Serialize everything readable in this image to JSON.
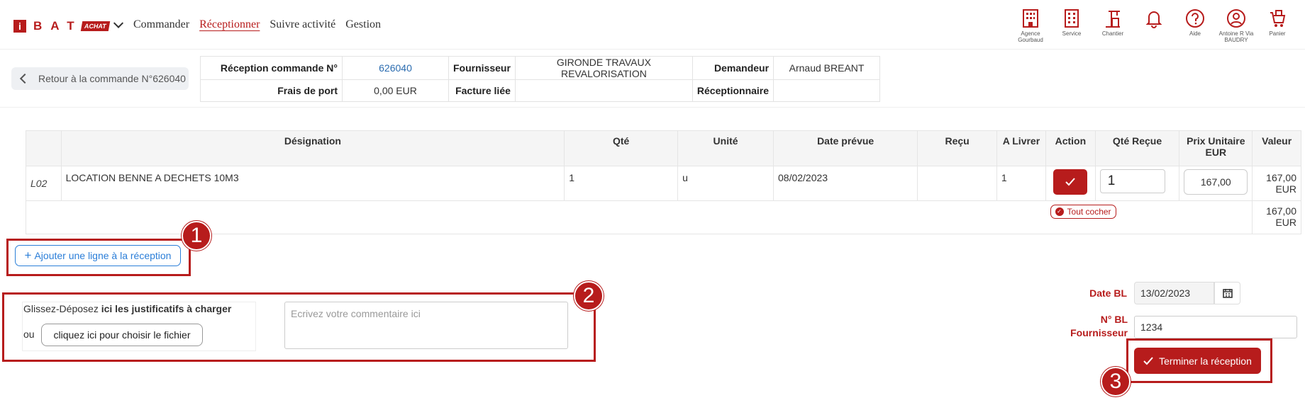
{
  "nav": {
    "logo_letters": "BAT",
    "logo_badge": "ACHAT",
    "menu": [
      "Commander",
      "Réceptionner",
      "Suivre activité",
      "Gestion"
    ],
    "icons": [
      {
        "label": "Agence Gourbaud"
      },
      {
        "label": "Service"
      },
      {
        "label": "Chantier"
      },
      {
        "label": ""
      },
      {
        "label": "Aide"
      },
      {
        "label": "Antoine R Via BAUDRY"
      },
      {
        "label": "Panier"
      }
    ]
  },
  "back_button": "Retour à la commande N°626040",
  "info": {
    "reception_label": "Réception commande N°",
    "reception_value": "626040",
    "fournisseur_label": "Fournisseur",
    "fournisseur_value": "GIRONDE TRAVAUX REVALORISATION",
    "demandeur_label": "Demandeur",
    "demandeur_value": "Arnaud BREANT",
    "frais_label": "Frais de port",
    "frais_value": "0,00 EUR",
    "facture_label": "Facture liée",
    "facture_value": "",
    "receptionnaire_label": "Réceptionnaire",
    "receptionnaire_value": ""
  },
  "table": {
    "headers": [
      "",
      "Désignation",
      "Qté",
      "Unité",
      "Date prévue",
      "Reçu",
      "A Livrer",
      "Action",
      "Qté Reçue",
      "Prix Unitaire EUR",
      "Valeur"
    ],
    "row": {
      "code": "L02",
      "designation": "LOCATION BENNE A DECHETS 10M3",
      "qte": "1",
      "unite": "u",
      "date_prevue": "08/02/2023",
      "recu": "",
      "a_livrer": "1",
      "qte_recue": "1",
      "prix_unitaire": "167,00",
      "valeur": "167,00 EUR"
    },
    "tout_cocher": "Tout cocher",
    "total": "167,00 EUR"
  },
  "add_line": "Ajouter une ligne à la réception",
  "upload": {
    "text_prefix": "Glissez-Déposez ",
    "text_bold": "ici les justificatifs à charger",
    "ou": "ou",
    "button": "cliquez ici pour choisir le fichier"
  },
  "comment_placeholder": "Ecrivez votre commentaire ici",
  "date_bl_label": "Date BL",
  "date_bl_value": "13/02/2023",
  "bl_label": "N° BL Fournisseur",
  "bl_value": "1234",
  "finish_button": "Terminer la réception",
  "annotations": [
    "1",
    "2",
    "3"
  ],
  "colors": {
    "accent": "#b71c1c",
    "link": "#2b7ed8"
  }
}
